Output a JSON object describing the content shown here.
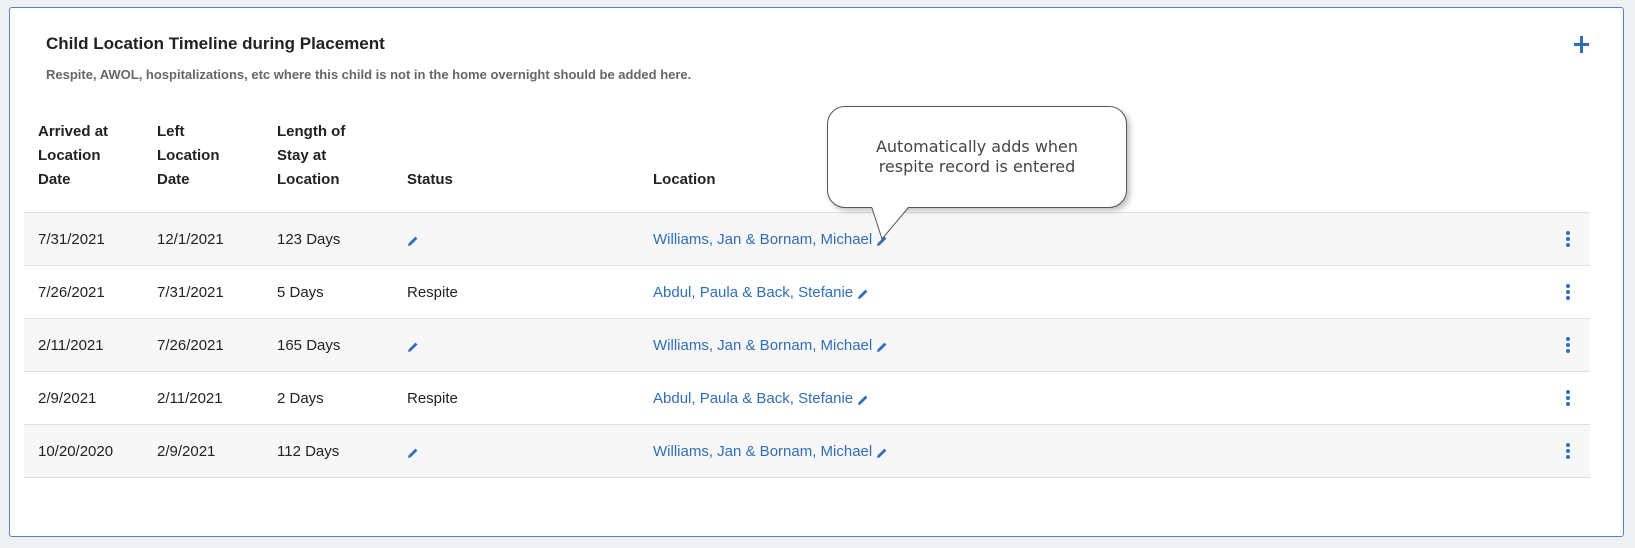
{
  "panel": {
    "title": "Child Location Timeline during Placement",
    "subtitle": "Respite, AWOL, hospitalizations, etc where this child is not in the home overnight should be added here.",
    "add_icon": "plus-icon"
  },
  "table": {
    "headers": {
      "arrived": "Arrived at Location Date",
      "left": "Left Location Date",
      "length": "Length of Stay at Location",
      "status": "Status",
      "location": "Location"
    },
    "rows": [
      {
        "arrived": "7/31/2021",
        "left": "12/1/2021",
        "length": "123 Days",
        "status": "",
        "location": "Williams, Jan & Bornam, Michael"
      },
      {
        "arrived": "7/26/2021",
        "left": "7/31/2021",
        "length": "5 Days",
        "status": "Respite",
        "location": "Abdul, Paula & Back, Stefanie"
      },
      {
        "arrived": "2/11/2021",
        "left": "7/26/2021",
        "length": "165 Days",
        "status": "",
        "location": "Williams, Jan & Bornam, Michael"
      },
      {
        "arrived": "2/9/2021",
        "left": "2/11/2021",
        "length": "2 Days",
        "status": "Respite",
        "location": "Abdul, Paula & Back, Stefanie"
      },
      {
        "arrived": "10/20/2020",
        "left": "2/9/2021",
        "length": "112 Days",
        "status": "",
        "location": "Williams, Jan & Bornam, Michael"
      }
    ]
  },
  "callout": {
    "text": "Automatically adds when respite record is entered"
  },
  "colors": {
    "accent": "#2f6fb8",
    "border": "#4a86c8"
  }
}
